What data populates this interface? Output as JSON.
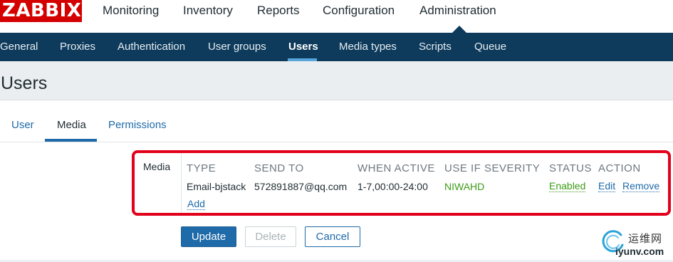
{
  "app": {
    "logo_text": "ZABBIX",
    "colors": {
      "brand": "#d40000",
      "nav_bg": "#0e3b5c",
      "accent": "#1f6aa8",
      "ok": "#3d9b18",
      "highlight": "#e2001a"
    }
  },
  "main_menu": {
    "items": [
      {
        "label": "Monitoring"
      },
      {
        "label": "Inventory"
      },
      {
        "label": "Reports"
      },
      {
        "label": "Configuration"
      },
      {
        "label": "Administration",
        "active": true
      }
    ]
  },
  "sub_menu": {
    "items": [
      {
        "label": "General"
      },
      {
        "label": "Proxies"
      },
      {
        "label": "Authentication"
      },
      {
        "label": "User groups"
      },
      {
        "label": "Users",
        "active": true
      },
      {
        "label": "Media types"
      },
      {
        "label": "Scripts"
      },
      {
        "label": "Queue"
      }
    ]
  },
  "page": {
    "title": "Users"
  },
  "tabs": [
    {
      "label": "User"
    },
    {
      "label": "Media",
      "active": true
    },
    {
      "label": "Permissions"
    }
  ],
  "media": {
    "label": "Media",
    "columns": [
      "TYPE",
      "SEND TO",
      "WHEN ACTIVE",
      "USE IF SEVERITY",
      "STATUS",
      "ACTION"
    ],
    "rows": [
      {
        "type": "Email-bjstack",
        "send_to": "572891887@qq.com",
        "when_active": "1-7,00:00-24:00",
        "severity": "NIWAHD",
        "status": "Enabled",
        "edit_label": "Edit",
        "remove_label": "Remove"
      }
    ],
    "add_label": "Add"
  },
  "buttons": {
    "update": "Update",
    "delete": "Delete",
    "cancel": "Cancel"
  },
  "watermark": {
    "cn_text": "运维网",
    "url_text": "iyunv.com"
  }
}
